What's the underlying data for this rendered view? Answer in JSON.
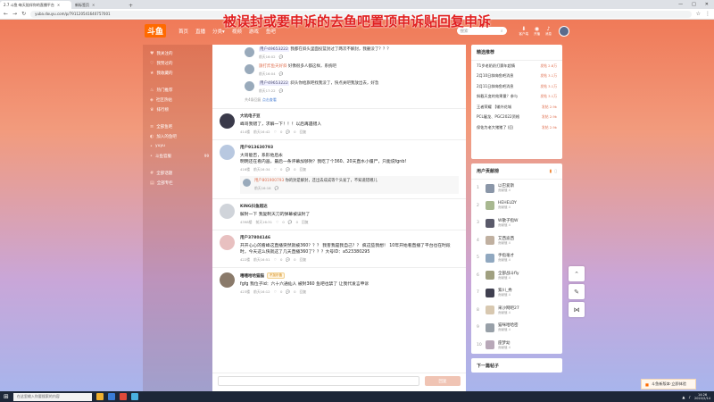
{
  "browser": {
    "tabs": [
      {
        "title": "2.7 斗鱼·每天陪伴你的直播平台",
        "active": true
      },
      {
        "title": "新标签页",
        "active": false
      }
    ],
    "new_tab": "+",
    "url": "yuba.douyu.com/p/791120541640757001",
    "controls": {
      "minimize": "—",
      "maximize": "□",
      "close": "✕"
    }
  },
  "overlay_title": "被误封或要申诉的去鱼吧置顶申诉贴回复申诉",
  "header": {
    "logo": "斗鱼",
    "nav": [
      "首页",
      "直播",
      "分类▾",
      "视频",
      "游戏",
      "鱼吧"
    ],
    "search_placeholder": "搜索",
    "icons": [
      {
        "label": "客户端",
        "icon": "download-icon"
      },
      {
        "label": "开播",
        "icon": "camera-icon"
      },
      {
        "label": "消息",
        "icon": "bell-icon"
      }
    ]
  },
  "sidebar": {
    "group1": [
      {
        "label": "我关注的",
        "icon": "heart-icon"
      },
      {
        "label": "我赞过的",
        "icon": "like-icon"
      },
      {
        "label": "我收藏的",
        "icon": "star-icon"
      }
    ],
    "group2": [
      {
        "label": "热门推荐",
        "icon": "fire-icon"
      },
      {
        "label": "社区热帖",
        "icon": "hot-icon"
      },
      {
        "label": "排行榜",
        "icon": "trophy-icon"
      }
    ],
    "group3": [
      {
        "label": "全部鱼吧",
        "icon": "list-icon"
      },
      {
        "label": "加入的鱼吧",
        "icon": "fish-icon"
      },
      {
        "label": "yuyu",
        "icon": "dot-icon",
        "count": ""
      },
      {
        "label": "斗鱼官服",
        "icon": "dot-icon",
        "count": "99"
      }
    ],
    "group4": [
      {
        "label": "全部话题",
        "icon": "topic-icon"
      },
      {
        "label": "全部专栏",
        "icon": "column-icon"
      }
    ]
  },
  "replies": [
    {
      "user": "用户49653222",
      "text": "我都在斜头里面投篮封过了两次不解封，我删没了？？？",
      "time": "前天16:02",
      "boxed": true
    },
    {
      "user": "旗打炸鱼天好斜",
      "text": "好像很多人都这样，系统吧",
      "time": "前天16:04",
      "boxed": false
    },
    {
      "user": "用户49653222",
      "text": "斜头你给旗吧找我没了，快点关吧我放出去，好急",
      "time": "前天17:22",
      "boxed": true
    }
  ],
  "replies_more": {
    "prefix": "共4条回复",
    "link": "点击查看"
  },
  "posts": [
    {
      "user": "大坑电子豆",
      "text": "峰哥我错了，求解一下！！！以后再遇错人",
      "time": "前天16:42",
      "counts": [
        "414楼",
        "0",
        "0",
        "回复"
      ]
    },
    {
      "user": "用户913630793",
      "text": "大哥能否，系形他后永\n明明还在看内画，最后一条评幕加够封？我吃了个360、20天直水小僵尸，只能说fgnb!",
      "time": "前天16:34",
      "counts": [
        "416楼",
        "0",
        "0",
        "回复"
      ],
      "inner": {
        "user": "用户801900793",
        "text": "你的封是解封，还出去成成等个头发了，不知道错哪儿",
        "time": "前天16:16"
      }
    },
    {
      "user": "KING抖鱼超达",
      "text": "解封一下 我复制天刀的弹幕被误封了",
      "time": "前天16:31",
      "counts": [
        "4398楼",
        "0",
        "0",
        "回复"
      ]
    },
    {
      "user": "用户37804146",
      "text": "开开心心的看峰这直播突然就被360？？？ 我害我是我自己？？ 疯这些我想！ 10年开始看直播了平台也在时段时，今天这么快就这了几天直播360了？？？大号ID：a523380295",
      "time": "前天16:51",
      "counts": [
        "422楼",
        "0",
        "0",
        "回复"
      ]
    },
    {
      "user": "嘻嘻哈哈猫猫",
      "tag": "不加乐值",
      "text": "fgfg 我位子id：六十六通仙人 被封360 鱼吧也禁了 让我代发言申诉",
      "time": "前天16:12",
      "counts": [
        "423楼",
        "0",
        "0",
        "回复"
      ]
    }
  ],
  "composer": {
    "button": "回复"
  },
  "recommend": {
    "title": "精选推荐",
    "items": [
      {
        "text": "71岁老奶奶打赛年超情",
        "count": "发帖 2.8万"
      },
      {
        "text": "2月10日斜嗨鱼吧消息",
        "count": "发帖 3.1万"
      },
      {
        "text": "2月11日斜嗨鱼吧消息",
        "count": "发帖 3.1万"
      },
      {
        "text": "斜截天变的效果量？参与",
        "count": "发帖 3.1万"
      },
      {
        "text": "王者荣耀 【输外花城",
        "count": "发帖 2.9k"
      },
      {
        "text": "PCL屠龙、PGC2022资格",
        "count": "发帖 2.9k"
      },
      {
        "text": "保佑为老大猪猪了 (回",
        "count": "发帖 2.9k"
      }
    ]
  },
  "ranking": {
    "title": "用户贡献榜",
    "items": [
      {
        "n": "1",
        "name": "以巴爱斯",
        "sub": "贡献值 4"
      },
      {
        "n": "2",
        "name": "HEHELDY",
        "sub": "贡献值 4"
      },
      {
        "n": "3",
        "name": "W散子指W",
        "sub": "贡献值 4"
      },
      {
        "n": "4",
        "name": "艾西迪西",
        "sub": "贡献值 4"
      },
      {
        "n": "5",
        "name": "手指毫才",
        "sub": "贡献值 4"
      },
      {
        "n": "6",
        "name": "全部战斗fly",
        "sub": "贡献值 4"
      },
      {
        "n": "7",
        "name": "紫川_秀",
        "sub": "贡献值 4"
      },
      {
        "n": "8",
        "name": "采沙网吧27",
        "sub": "贡献值 4"
      },
      {
        "n": "9",
        "name": "猫咪哈哈密",
        "sub": "贡献值 4"
      },
      {
        "n": "10",
        "name": "座梦幼",
        "sub": "贡献值 4"
      }
    ]
  },
  "next_post": "下一篇帖子",
  "fabs": [
    {
      "icon": "arrow-up-icon",
      "glyph": "⌃"
    },
    {
      "icon": "edit-icon",
      "glyph": "✎"
    },
    {
      "icon": "share-icon",
      "glyph": "⋈"
    }
  ],
  "promo": {
    "text": "斗鱼新版本·立即体验"
  },
  "taskbar": {
    "search_placeholder": "在这里输入你要搜索的内容",
    "time": "14:26",
    "date": "2022/2/14"
  },
  "colors": {
    "accent": "#ff6a00",
    "link": "#4a7fd4",
    "overlay": "#e02020"
  }
}
